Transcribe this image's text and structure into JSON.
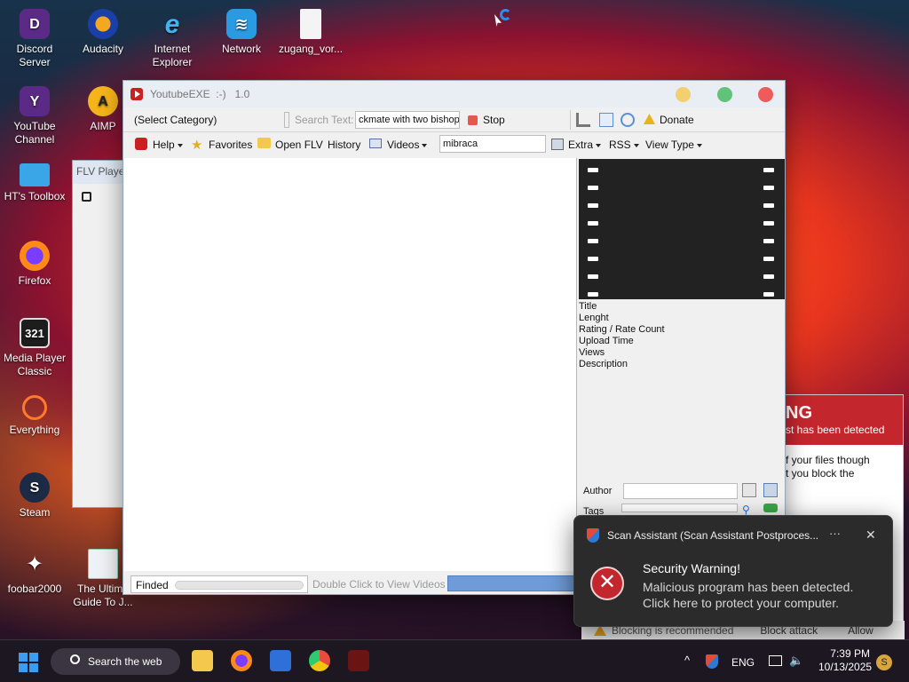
{
  "desktop": {
    "icons": [
      {
        "label": "Discord\nServer"
      },
      {
        "label": "Audacity"
      },
      {
        "label": "Internet\nExplorer"
      },
      {
        "label": "Network"
      },
      {
        "label": "zugang_vor..."
      },
      {
        "label": "YouTube\nChannel"
      },
      {
        "label": "AIMP"
      },
      {
        "label": "HT's Toolbox"
      },
      {
        "label": "Firefox"
      },
      {
        "label": "Media Player\nClassic"
      },
      {
        "label": "Everything"
      },
      {
        "label": "Steam"
      },
      {
        "label": "foobar2000"
      },
      {
        "label": "The Ultima\nGuide To J..."
      }
    ]
  },
  "flv_window": {
    "title": "FLV Player"
  },
  "warning_panel": {
    "heading": "NG",
    "subheading": "st has been detected",
    "body": "f your files though\nt you block the",
    "recommend": "Blocking is recommended",
    "block_button": "Block attack",
    "allow_button": "Allow"
  },
  "app": {
    "title": "YoutubeEXE  :-)   1.0",
    "toolbar1": {
      "category": "(Select Category)",
      "search_label": "Search Text:",
      "search_value": "ckmate with two bishops",
      "stop": "Stop",
      "donate": "Donate"
    },
    "toolbar2": {
      "help": "Help",
      "favorites": "Favorites",
      "open_flv": "Open FLV",
      "history": "History",
      "videos": "Videos",
      "filter_value": "mibraca",
      "extra": "Extra",
      "rss": "RSS",
      "view_type": "View Type"
    },
    "info": {
      "title": "Title",
      "length": "Lenght",
      "rating": "Rating / Rate Count",
      "upload": "Upload Time",
      "views": "Views",
      "description": "Description"
    },
    "author_label": "Author",
    "tags_label": "Tags",
    "status": {
      "state": "Finded",
      "hint": "Double Click to View Videos"
    }
  },
  "toast": {
    "app_name": "Scan Assistant (Scan Assistant Postproces...",
    "more": "···",
    "close": "✕",
    "heading": "Security Warning!",
    "message": "Malicious program has been detected.\nClick here to protect your computer."
  },
  "taskbar": {
    "search_label": "Search the web",
    "language": "ENG",
    "time": "7:39 PM",
    "date": "10/13/2025",
    "user_initial": "S"
  }
}
